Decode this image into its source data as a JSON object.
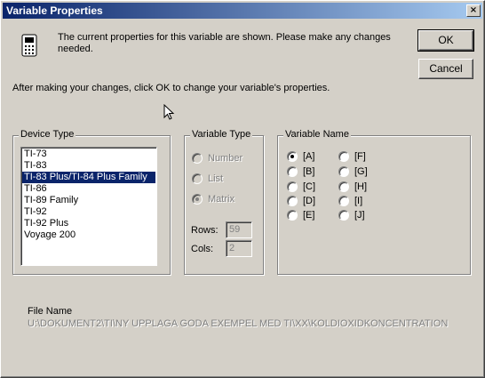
{
  "window": {
    "title": "Variable Properties",
    "close_glyph": "×"
  },
  "intro": {
    "line1": "The current properties for this variable are shown.  Please make any changes",
    "line2": "needed.",
    "instruction": "After making your changes, click OK to change your variable's properties."
  },
  "buttons": {
    "ok": "OK",
    "cancel": "Cancel"
  },
  "device_type": {
    "label": "Device Type",
    "items": [
      "TI-73",
      "TI-83",
      "TI-83 Plus/TI-84 Plus Family",
      "TI-86",
      "TI-89 Family",
      "TI-92",
      "TI-92 Plus",
      "Voyage 200"
    ],
    "selected": "TI-83 Plus/TI-84 Plus Family"
  },
  "variable_type": {
    "label": "Variable Type",
    "options": [
      "Number",
      "List",
      "Matrix"
    ],
    "selected": "Matrix",
    "rows_label": "Rows:",
    "rows_value": "59",
    "cols_label": "Cols:",
    "cols_value": "2"
  },
  "variable_name": {
    "label": "Variable Name",
    "left": [
      "[A]",
      "[B]",
      "[C]",
      "[D]",
      "[E]"
    ],
    "right": [
      "[F]",
      "[G]",
      "[H]",
      "[I]",
      "[J]"
    ],
    "selected": "[A]"
  },
  "file": {
    "label": "File Name",
    "path": "U:\\DOKUMENT2\\TI\\NY UPPLAGA GODA EXEMPEL MED TI\\XX\\KOLDIOXIDKONCENTRATION"
  }
}
